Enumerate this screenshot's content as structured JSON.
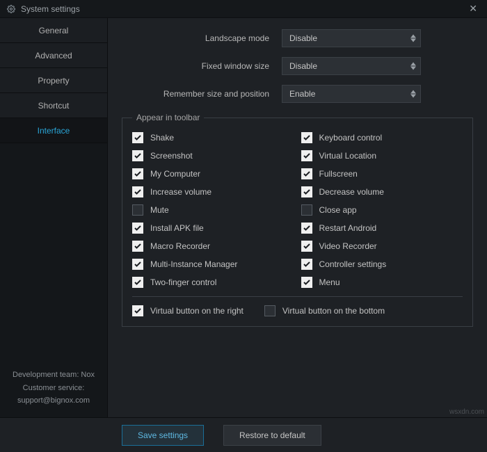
{
  "titlebar": {
    "title": "System settings"
  },
  "sidebar": {
    "tabs": [
      {
        "label": "General"
      },
      {
        "label": "Advanced"
      },
      {
        "label": "Property"
      },
      {
        "label": "Shortcut"
      },
      {
        "label": "Interface"
      }
    ],
    "footer": {
      "line1": "Development team: Nox",
      "line2": "Customer service:",
      "line3": "support@bignox.com"
    }
  },
  "form": {
    "landscape": {
      "label": "Landscape mode",
      "value": "Disable"
    },
    "fixed": {
      "label": "Fixed window size",
      "value": "Disable"
    },
    "remember": {
      "label": "Remember size and position",
      "value": "Enable"
    }
  },
  "toolbar_group": {
    "legend": "Appear in toolbar",
    "items": [
      {
        "label": "Shake",
        "checked": true
      },
      {
        "label": "Keyboard control",
        "checked": true
      },
      {
        "label": "Screenshot",
        "checked": true
      },
      {
        "label": "Virtual Location",
        "checked": true
      },
      {
        "label": "My Computer",
        "checked": true
      },
      {
        "label": "Fullscreen",
        "checked": true
      },
      {
        "label": "Increase volume",
        "checked": true
      },
      {
        "label": "Decrease volume",
        "checked": true
      },
      {
        "label": "Mute",
        "checked": false
      },
      {
        "label": "Close app",
        "checked": false
      },
      {
        "label": "Install APK file",
        "checked": true
      },
      {
        "label": "Restart Android",
        "checked": true
      },
      {
        "label": "Macro Recorder",
        "checked": true
      },
      {
        "label": "Video Recorder",
        "checked": true
      },
      {
        "label": "Multi-Instance Manager",
        "checked": true
      },
      {
        "label": "Controller settings",
        "checked": true
      },
      {
        "label": "Two-finger control",
        "checked": true
      },
      {
        "label": "Menu",
        "checked": true
      }
    ],
    "virtual_right": {
      "label": "Virtual button on the right",
      "checked": true
    },
    "virtual_bottom": {
      "label": "Virtual button on the bottom",
      "checked": false
    }
  },
  "actions": {
    "save": "Save settings",
    "restore": "Restore to default"
  },
  "watermark": "wsxdn.com"
}
